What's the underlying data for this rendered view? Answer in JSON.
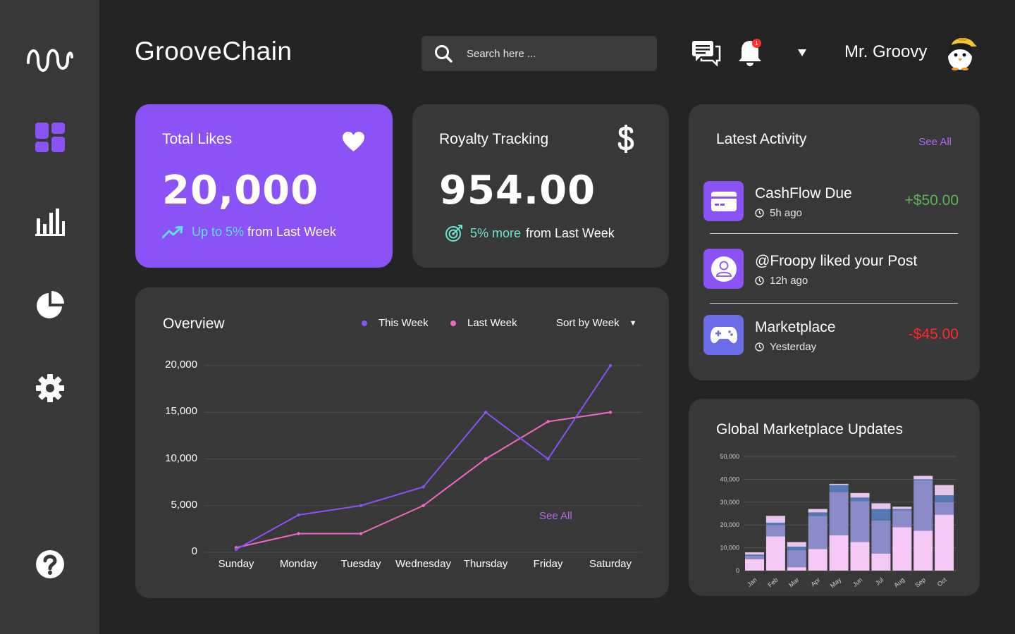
{
  "app": {
    "brand": "GrooveChain"
  },
  "search": {
    "placeholder": "Search here ..."
  },
  "header": {
    "notification_count": "1",
    "username": "Mr. Groovy"
  },
  "sidebar": {
    "items": [
      {
        "name": "dashboard",
        "icon": "dashboard-grid-icon",
        "active": true
      },
      {
        "name": "analytics",
        "icon": "bar-chart-icon"
      },
      {
        "name": "reports",
        "icon": "pie-chart-icon"
      },
      {
        "name": "settings",
        "icon": "gear-icon"
      },
      {
        "name": "help",
        "icon": "help-icon"
      }
    ]
  },
  "total_likes": {
    "title": "Total Likes",
    "value": "20,000",
    "change": "Up to 5%",
    "suffix": "from Last Week"
  },
  "royalty": {
    "title": "Royalty Tracking",
    "value": "954.00",
    "change": "5% more",
    "suffix": "from Last Week"
  },
  "overview": {
    "title": "Overview",
    "legend": [
      "This Week",
      "Last Week"
    ],
    "sort_label": "Sort by",
    "sort_value": "Week",
    "see_all": "See All"
  },
  "activity": {
    "title": "Latest Activity",
    "see_all": "See All",
    "items": [
      {
        "name": "CashFlow Due",
        "time": "5h ago",
        "amount": "+$50.00",
        "icon": "credit-card-icon"
      },
      {
        "name": "@Froopy liked your Post",
        "time": "12h ago",
        "amount": "",
        "icon": "user-icon"
      },
      {
        "name": "Marketplace",
        "time": "Yesterday",
        "amount": "-$45.00",
        "icon": "gamepad-icon"
      }
    ]
  },
  "marketplace": {
    "title": "Global Marketplace Updates"
  },
  "colors": {
    "accent_purple": "#8b52f7",
    "this_week": "#8b52f7",
    "last_week": "#f067c4",
    "positive": "#5fb358",
    "negative": "#ff2b2b",
    "link": "#b36cf2"
  },
  "chart_data": [
    {
      "type": "line",
      "x": [
        "Sunday",
        "Monday",
        "Tuesday",
        "Wednesday",
        "Thursday",
        "Friday",
        "Saturday"
      ],
      "ylim": [
        0,
        20000
      ],
      "yticks": [
        "20,000",
        "15,000",
        "10,000",
        "5,000",
        "0"
      ],
      "ytick_values": [
        20000,
        15000,
        10000,
        5000,
        0
      ],
      "grid": true,
      "series": [
        {
          "name": "This Week",
          "values": [
            300,
            4000,
            5000,
            7000,
            15000,
            10000,
            20000
          ]
        },
        {
          "name": "Last Week",
          "values": [
            500,
            2000,
            2000,
            5000,
            10000,
            14000,
            15000
          ]
        }
      ]
    },
    {
      "type": "bar",
      "stacked": true,
      "categories": [
        "Jan",
        "Feb",
        "Mar",
        "Apr",
        "May",
        "Jun",
        "Jul",
        "Aug",
        "Sep",
        "Oct"
      ],
      "ylim": [
        0,
        50000
      ],
      "yticks": [
        "50,000",
        "40,000",
        "30,000",
        "20,000",
        "10,000",
        "0"
      ],
      "ytick_values": [
        50000,
        40000,
        30000,
        20000,
        10000,
        0
      ],
      "grid": true,
      "series": [
        {
          "color": "#f6c8f6",
          "values": [
            5000,
            15000,
            1500,
            9500,
            15500,
            12500,
            7500,
            19000,
            17500,
            24500
          ]
        },
        {
          "color": "#8c8bc9",
          "values": [
            1500,
            5000,
            7500,
            14500,
            19000,
            18000,
            14500,
            7500,
            22000,
            5500
          ]
        },
        {
          "color": "#5378b3",
          "values": [
            500,
            1000,
            1500,
            1500,
            3000,
            1500,
            5000,
            500,
            500,
            3000
          ]
        },
        {
          "color": "#e7c6ea",
          "values": [
            1000,
            3000,
            2000,
            1500,
            500,
            2000,
            2500,
            1000,
            1500,
            4500
          ]
        }
      ]
    }
  ]
}
